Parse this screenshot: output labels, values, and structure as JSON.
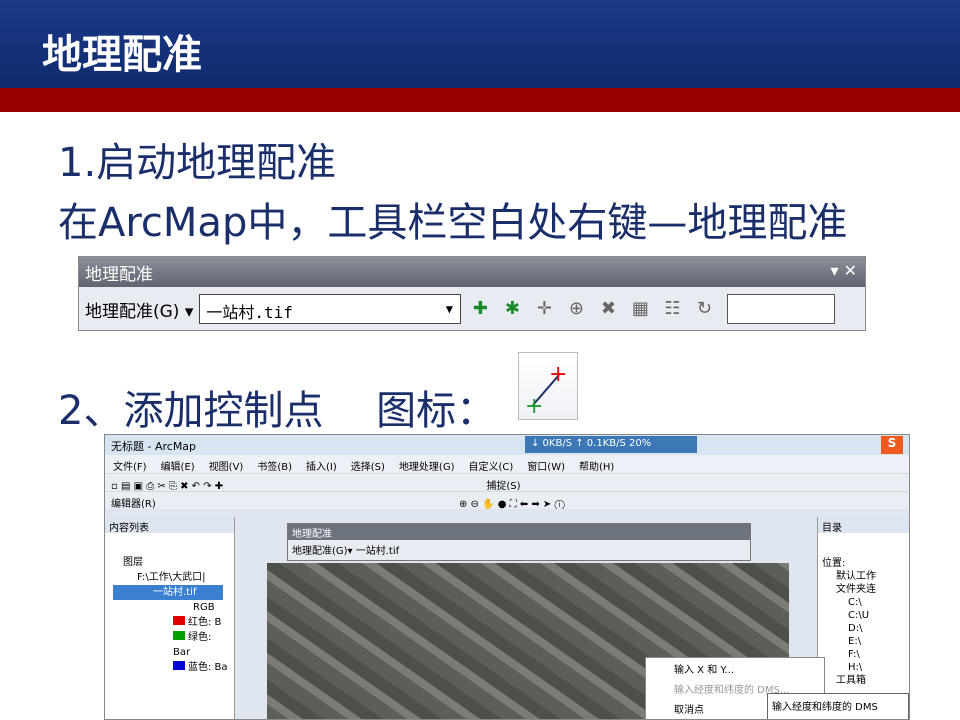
{
  "slide": {
    "title": "地理配准",
    "line1": "1.启动地理配准",
    "line2": "在ArcMap中，工具栏空白处右键—地理配准",
    "line3": "2、添加控制点　  图标："
  },
  "toolbar": {
    "caption": "地理配准",
    "controls": "▾ ✕",
    "menu_label": "地理配准(G)",
    "menu_arrow": "▾",
    "layer_combo": "一站村.tif",
    "icons": [
      "add-control-points-icon",
      "auto-register-icon",
      "select-link-icon",
      "zoom-to-link-icon",
      "delete-link-icon",
      "view-link-table-icon",
      "view-table-icon",
      "rotate-icon"
    ]
  },
  "screenshot": {
    "title": "无标题 - ArcMap",
    "download_text": "↓ 0KB/S  ↑ 0.1KB/S  20%",
    "menus": [
      "文件(F)",
      "编辑(E)",
      "视图(V)",
      "书签(B)",
      "插入(I)",
      "选择(S)",
      "地理处理(G)",
      "自定义(C)",
      "窗口(W)",
      "帮助(H)"
    ],
    "snap_label": "捕捉(S)",
    "editor_label": "编辑器(R)",
    "toc_title": "内容列表",
    "toc_items": [
      "图层",
      "F:\\工作\\大武口|",
      "一站村.tif",
      "RGB",
      "红色: B",
      "绿色: Bar",
      "蓝色: Ba"
    ],
    "catalog_title": "目录",
    "catalog_location": "位置:",
    "catalog_items": [
      "默认工作",
      "文件夹连",
      "C:\\",
      "C:\\U",
      "D:\\",
      "E:\\",
      "F:\\",
      "H:\\",
      "工具箱"
    ],
    "float_caption": "地理配准",
    "float_row": "地理配准(G)▾ 一站村.tif",
    "context_items": [
      "输入 X 和 Y...",
      "输入经度和纬度的 DMS...",
      "取消点"
    ],
    "tooltip": "输入经度和纬度的 DMS",
    "colors": {
      "red": "#e00000",
      "green": "#00a000",
      "blue": "#0000d0"
    }
  }
}
